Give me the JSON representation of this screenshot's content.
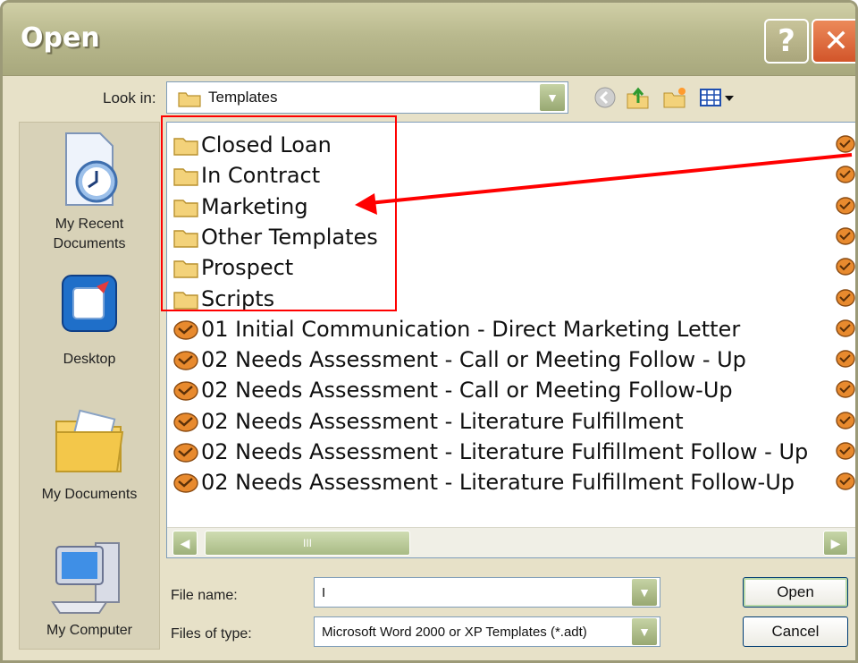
{
  "window": {
    "title": "Open",
    "help_glyph": "?",
    "close_glyph": "✕"
  },
  "look_in": {
    "label": "Look in:",
    "value": "Templates"
  },
  "places": [
    {
      "label": "My Recent\nDocuments",
      "icon": "recent-documents-icon"
    },
    {
      "label": "Desktop",
      "icon": "desktop-icon"
    },
    {
      "label": "My Documents",
      "icon": "my-documents-icon"
    },
    {
      "label": "My Computer",
      "icon": "my-computer-icon"
    }
  ],
  "files": {
    "folders": [
      "Closed Loan",
      "In Contract",
      "Marketing",
      "Other Templates",
      "Prospect",
      "Scripts"
    ],
    "documents": [
      "01 Initial Communication - Direct Marketing Letter",
      "02 Needs Assessment - Call or Meeting Follow - Up",
      "02 Needs Assessment - Call or Meeting Follow-Up",
      "02 Needs Assessment - Literature Fulfillment",
      "02 Needs Assessment - Literature Fulfillment Follow - Up",
      "02 Needs Assessment - Literature Fulfillment Follow-Up"
    ]
  },
  "scrollbar": {
    "thumb_grip": "III"
  },
  "file_name": {
    "label": "File name:",
    "value": "I"
  },
  "files_of_type": {
    "label": "Files of type:",
    "value": "Microsoft Word 2000 or XP Templates (*.adt)"
  },
  "buttons": {
    "open": "Open",
    "cancel": "Cancel"
  },
  "colors": {
    "annotation": "#ff0000",
    "folder": "#f3d27a",
    "accent": "#98a872"
  }
}
